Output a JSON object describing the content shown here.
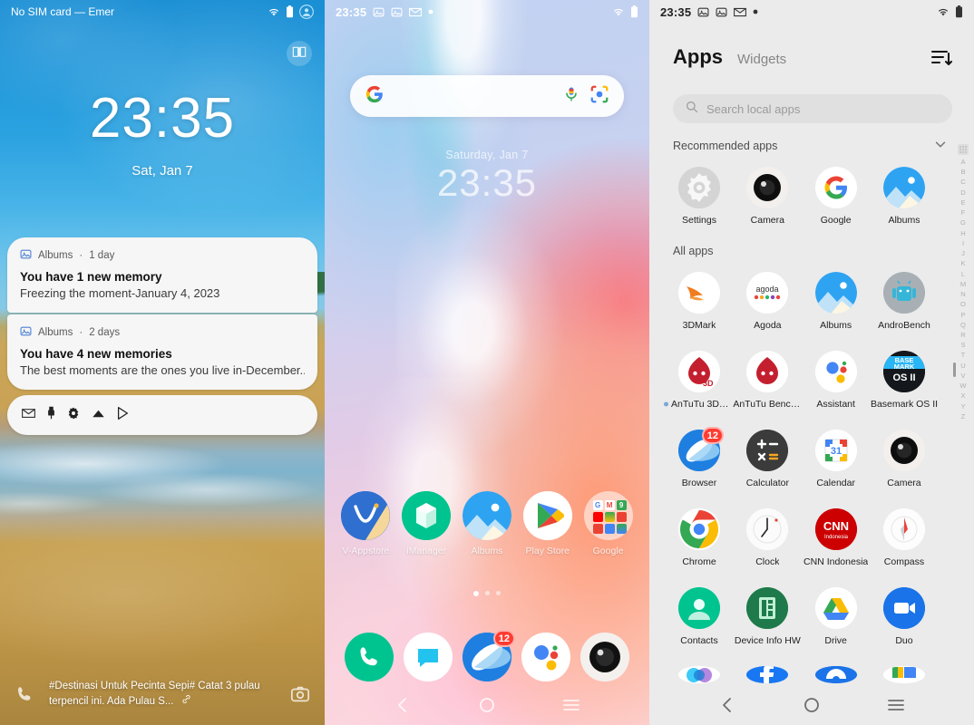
{
  "panels": {
    "lockscreen": {
      "statusbar": {
        "carrier": "No SIM card — Emer",
        "wifi_icon": "wifi-icon",
        "battery_icon": "battery-icon",
        "account_icon": "account-icon"
      },
      "jovi_icon": "book-icon",
      "clock": {
        "time": "23:35",
        "date": "Sat, Jan 7"
      },
      "notifications": [
        {
          "app_icon": "albums-icon",
          "app": "Albums",
          "separator": "·",
          "time": "1 day",
          "title": "You have 1 new memory",
          "body": "Freezing the moment-January 4, 2023"
        },
        {
          "app_icon": "albums-icon",
          "app": "Albums",
          "separator": "·",
          "time": "2 days",
          "title": "You have 4 new memories",
          "body": "The best moments are the ones you live in-December.."
        }
      ],
      "mini_notifications": [
        "gmail-icon",
        "pin-icon",
        "settings-flower-icon",
        "drive-cloud-icon",
        "play-icon"
      ],
      "bottom": {
        "phone_icon": "phone-icon",
        "camera_icon": "camera-icon",
        "caption": "#Destinasi Untuk Pecinta Sepi#  Catat 3 pulau terpencil ini. Ada Pulau S...",
        "link_icon": "link-icon"
      }
    },
    "homescreen": {
      "statusbar": {
        "time": "23:35",
        "icons": [
          "photo-icon",
          "photo-icon",
          "gmail-icon",
          "dot-icon"
        ],
        "wifi_icon": "wifi-icon",
        "battery_icon": "battery-icon"
      },
      "search": {
        "google_icon": "google-g-icon",
        "mic_icon": "microphone-icon",
        "lens_icon": "google-lens-icon",
        "placeholder": ""
      },
      "clock": {
        "date": "Saturday, Jan 7",
        "time": "23:35"
      },
      "apps": [
        {
          "label": "V-Appstore",
          "icon": "v-appstore-icon"
        },
        {
          "label": "iManager",
          "icon": "imanager-icon"
        },
        {
          "label": "Albums",
          "icon": "albums-icon"
        },
        {
          "label": "Play Store",
          "icon": "play-store-icon"
        },
        {
          "label": "Google",
          "icon": "google-folder-icon"
        }
      ],
      "page_dots": 3,
      "active_dot": 0,
      "dock": [
        {
          "label": "Phone",
          "icon": "phone-icon",
          "badge": ""
        },
        {
          "label": "Messages",
          "icon": "messages-icon",
          "badge": ""
        },
        {
          "label": "Browser",
          "icon": "browser-icon",
          "badge": "12"
        },
        {
          "label": "Assistant",
          "icon": "assistant-icon",
          "badge": ""
        },
        {
          "label": "Camera",
          "icon": "camera-icon",
          "badge": ""
        }
      ],
      "nav": {
        "back": "back-icon",
        "home": "home-icon",
        "recents": "recents-icon"
      }
    },
    "appdrawer": {
      "statusbar": {
        "time": "23:35",
        "icons": [
          "photo-icon",
          "photo-icon",
          "gmail-icon",
          "dot-icon"
        ],
        "wifi_icon": "wifi-icon",
        "battery_icon": "battery-icon"
      },
      "tabs": {
        "apps": "Apps",
        "widgets": "Widgets"
      },
      "sort_icon": "sort-icon",
      "search": {
        "icon": "search-icon",
        "placeholder": "Search local apps"
      },
      "sections": {
        "recommended": {
          "title": "Recommended apps",
          "chevron": "chevron-down-icon"
        },
        "all": {
          "title": "All apps"
        }
      },
      "recommended_apps": [
        {
          "label": "Settings",
          "icon": "settings-icon"
        },
        {
          "label": "Camera",
          "icon": "camera-icon"
        },
        {
          "label": "Google",
          "icon": "google-g-icon"
        },
        {
          "label": "Albums",
          "icon": "albums-icon"
        }
      ],
      "all_apps": [
        {
          "label": "3DMark",
          "icon": "3dmark-icon",
          "badge": "",
          "dot": false
        },
        {
          "label": "Agoda",
          "icon": "agoda-icon",
          "badge": "",
          "dot": false
        },
        {
          "label": "Albums",
          "icon": "albums-icon",
          "badge": "",
          "dot": false
        },
        {
          "label": "AndroBench",
          "icon": "androbench-icon",
          "badge": "",
          "dot": false
        },
        {
          "label": "AnTuTu 3DB…",
          "icon": "antutu-3d-icon",
          "badge": "",
          "dot": true
        },
        {
          "label": "AnTuTu Bench…",
          "icon": "antutu-icon",
          "badge": "",
          "dot": false
        },
        {
          "label": "Assistant",
          "icon": "assistant-icon",
          "badge": "",
          "dot": false
        },
        {
          "label": "Basemark OS II",
          "icon": "basemark-icon",
          "badge": "",
          "dot": false
        },
        {
          "label": "Browser",
          "icon": "browser-icon",
          "badge": "12",
          "dot": false
        },
        {
          "label": "Calculator",
          "icon": "calculator-icon",
          "badge": "",
          "dot": false
        },
        {
          "label": "Calendar",
          "icon": "calendar-icon",
          "badge": "",
          "dot": false
        },
        {
          "label": "Camera",
          "icon": "camera-icon",
          "badge": "",
          "dot": false
        },
        {
          "label": "Chrome",
          "icon": "chrome-icon",
          "badge": "",
          "dot": false
        },
        {
          "label": "Clock",
          "icon": "clock-icon",
          "badge": "",
          "dot": false
        },
        {
          "label": "CNN Indonesia",
          "icon": "cnn-indonesia-icon",
          "badge": "",
          "dot": false
        },
        {
          "label": "Compass",
          "icon": "compass-icon",
          "badge": "",
          "dot": false
        },
        {
          "label": "Contacts",
          "icon": "contacts-icon",
          "badge": "",
          "dot": false
        },
        {
          "label": "Device Info HW",
          "icon": "device-info-hw-icon",
          "badge": "",
          "dot": false
        },
        {
          "label": "Drive",
          "icon": "drive-icon",
          "badge": "",
          "dot": false
        },
        {
          "label": "Duo",
          "icon": "duo-icon",
          "badge": "",
          "dot": false
        }
      ],
      "partial_row": [
        {
          "label": "",
          "icon": "photos-icon"
        },
        {
          "label": "",
          "icon": "facebook-icon"
        },
        {
          "label": "",
          "icon": "files-icon"
        },
        {
          "label": "",
          "icon": "google-slides-icon"
        }
      ],
      "az_index": [
        "A",
        "B",
        "C",
        "D",
        "E",
        "F",
        "G",
        "H",
        "I",
        "J",
        "K",
        "L",
        "M",
        "N",
        "O",
        "P",
        "Q",
        "R",
        "S",
        "T",
        "U",
        "V",
        "W",
        "X",
        "Y",
        "Z"
      ],
      "az_grid_icon": "grid-icon",
      "nav": {
        "back": "back-icon",
        "home": "home-icon",
        "recents": "recents-icon"
      }
    }
  },
  "colors": {
    "drawer_bg": "#ebebeb",
    "badge_red": "#ff3b30",
    "accent_blue": "#1a73e8",
    "green": "#00c48f"
  },
  "calendar_day": "31"
}
